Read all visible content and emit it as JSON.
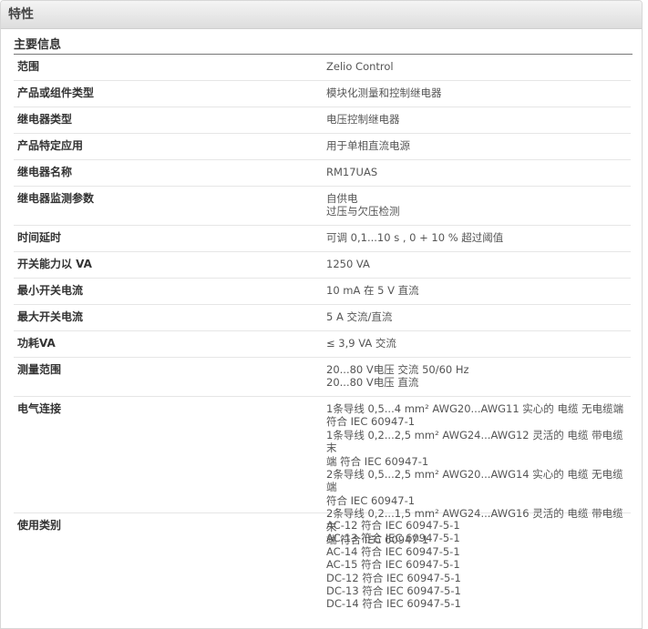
{
  "panel": {
    "title": "特性"
  },
  "section": {
    "title": "主要信息"
  },
  "rows": [
    {
      "label": "范围",
      "values": [
        "Zelio Control"
      ]
    },
    {
      "label": "产品或组件类型",
      "values": [
        "模块化测量和控制继电器"
      ]
    },
    {
      "label": "继电器类型",
      "values": [
        "电压控制继电器"
      ]
    },
    {
      "label": "产品特定应用",
      "values": [
        "用于单相直流电源"
      ]
    },
    {
      "label": "继电器名称",
      "values": [
        "RM17UAS"
      ]
    },
    {
      "label": "继电器监测参数",
      "values": [
        "自供电",
        "过压与欠压检测"
      ]
    },
    {
      "label": "时间延时",
      "values": [
        "可调 0,1...10 s , 0 + 10 % 超过阈值"
      ]
    },
    {
      "label": "开关能力以 VA",
      "values": [
        "1250 VA"
      ]
    },
    {
      "label": "最小开关电流",
      "values": [
        "10 mA 在 5 V 直流"
      ]
    },
    {
      "label": "最大开关电流",
      "values": [
        "5 A 交流/直流"
      ]
    },
    {
      "label": "功耗VA",
      "values": [
        "≤ 3,9 VA 交流"
      ]
    },
    {
      "label": "测量范围",
      "values": [
        "20...80 V电压 交流 50/60 Hz",
        "20...80 V电压 直流"
      ]
    },
    {
      "label": "电气连接",
      "values": [
        "1条导线 0,5...4 mm² AWG20...AWG11 实心的 电缆 无电缆端",
        "符合 IEC 60947-1",
        "1条导线 0,2...2,5 mm² AWG24...AWG12 灵活的 电缆 带电缆末",
        "端 符合 IEC 60947-1",
        "2条导线 0,5...2,5 mm² AWG20...AWG14 实心的 电缆 无电缆端",
        "符合 IEC 60947-1",
        "2条导线 0,2...1,5 mm² AWG24...AWG16 灵活的 电缆 带电缆末",
        "端 符合 IEC 60947-1"
      ]
    },
    {
      "label": "使用类别",
      "values": [
        "AC-12 符合 IEC 60947-5-1",
        "AC-13 符合 IEC 60947-5-1",
        "AC-14 符合 IEC 60947-5-1",
        "AC-15 符合 IEC 60947-5-1",
        "DC-12 符合 IEC 60947-5-1",
        "DC-13 符合 IEC 60947-5-1",
        "DC-14 符合 IEC 60947-5-1"
      ]
    }
  ]
}
